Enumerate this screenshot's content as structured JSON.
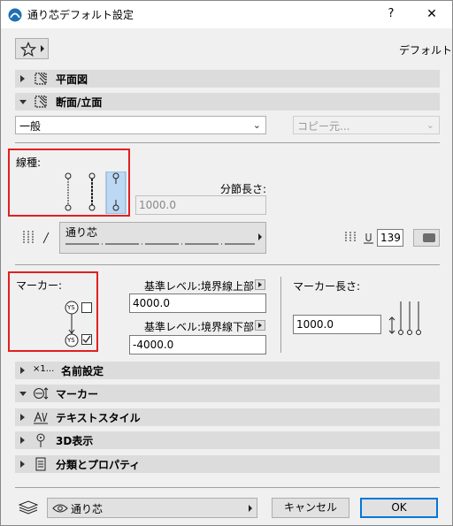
{
  "window": {
    "title": "通り芯デフォルト設定",
    "help": "?",
    "close": "✕"
  },
  "favorites": {
    "default_label": "デフォルト"
  },
  "panels": {
    "floor_plan": "平面図",
    "section": "断面/立面",
    "name_settings_prefix": "×1...",
    "name_settings": "名前設定",
    "marker": "マーカー",
    "text_style": "テキストスタイル",
    "view_3d": "3D表示",
    "classification": "分類とプロパティ"
  },
  "section": {
    "general_select": "一般",
    "copy_source_select": "コピー元..."
  },
  "line_type": {
    "label": "線種:",
    "segment_length_label": "分節長さ:",
    "segment_length_value": "1000.0",
    "linetype_name": "通り芯",
    "pen_number": "139"
  },
  "marker": {
    "label": "マーカー:",
    "top_ref_label": "基準レベル:境界線上部",
    "top_ref_value": "4000.0",
    "bottom_ref_label": "基準レベル:境界線下部",
    "bottom_ref_value": "-4000.0",
    "marker_length_label": "マーカー長さ:",
    "marker_length_value": "1000.0",
    "ys_top": "YS",
    "ys_bottom": "YS"
  },
  "footer": {
    "layer_select": "通り芯",
    "cancel": "キャンセル",
    "ok": "OK"
  },
  "colors": {
    "highlight_red": "#e02020",
    "accent_blue": "#0078d7",
    "header_gray": "#dcdcdc"
  }
}
